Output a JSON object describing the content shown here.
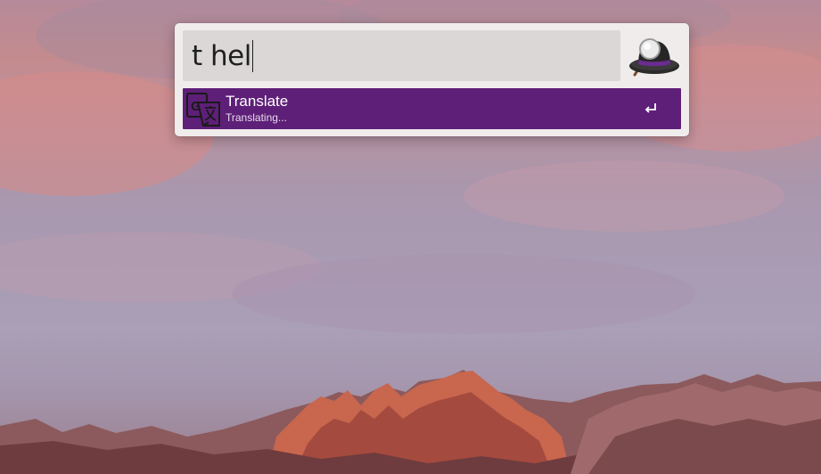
{
  "launcher": {
    "query": "t hel",
    "app_icon": "alfred-hat-icon",
    "results": [
      {
        "icon": "google-translate-icon",
        "title": "Translate",
        "subtitle": "Translating...",
        "action_icon": "return-icon"
      }
    ]
  },
  "desktop": {
    "wallpaper": "mountain-sunset-wallpaper"
  },
  "colors": {
    "selected_row": "#5e1f78",
    "launcher_bg": "#f0ecec",
    "search_field": "#dbd7d7"
  }
}
